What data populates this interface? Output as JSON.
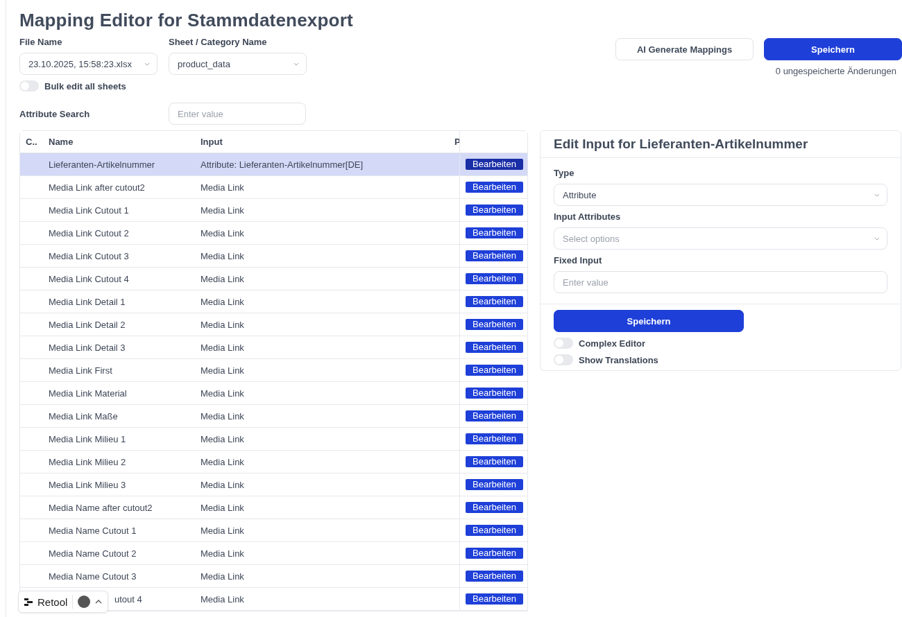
{
  "title": "Mapping Editor for Stammdatenexport",
  "file_name": {
    "label": "File Name",
    "value": "23.10.2025, 15:58:23.xlsx"
  },
  "sheet": {
    "label": "Sheet / Category Name",
    "value": "product_data"
  },
  "bulk_edit": {
    "label": "Bulk edit all sheets",
    "on": false
  },
  "ai_button": "AI Generate Mappings",
  "save_button": "Speichern",
  "unsaved": "0 ungespeicherte Änderungen",
  "attribute_search": {
    "label": "Attribute Search",
    "placeholder": "Enter value"
  },
  "table": {
    "columns": [
      "C..",
      "Name",
      "Input",
      "P"
    ],
    "rows": [
      {
        "name": "Lieferanten-Artikelnummer",
        "input": "Attribute: Lieferanten-Artikelnummer[DE]",
        "action": "Bearbeiten",
        "selected": true
      },
      {
        "name": "Media Link after cutout2",
        "input": "Media Link",
        "action": "Bearbeiten",
        "selected": false
      },
      {
        "name": "Media Link Cutout 1",
        "input": "Media Link",
        "action": "Bearbeiten",
        "selected": false
      },
      {
        "name": "Media Link Cutout 2",
        "input": "Media Link",
        "action": "Bearbeiten",
        "selected": false
      },
      {
        "name": "Media Link Cutout 3",
        "input": "Media Link",
        "action": "Bearbeiten",
        "selected": false
      },
      {
        "name": "Media Link Cutout 4",
        "input": "Media Link",
        "action": "Bearbeiten",
        "selected": false
      },
      {
        "name": "Media Link Detail 1",
        "input": "Media Link",
        "action": "Bearbeiten",
        "selected": false
      },
      {
        "name": "Media Link Detail 2",
        "input": "Media Link",
        "action": "Bearbeiten",
        "selected": false
      },
      {
        "name": "Media Link Detail 3",
        "input": "Media Link",
        "action": "Bearbeiten",
        "selected": false
      },
      {
        "name": "Media Link First",
        "input": "Media Link",
        "action": "Bearbeiten",
        "selected": false
      },
      {
        "name": "Media Link Material",
        "input": "Media Link",
        "action": "Bearbeiten",
        "selected": false
      },
      {
        "name": "Media Link Maße",
        "input": "Media Link",
        "action": "Bearbeiten",
        "selected": false
      },
      {
        "name": "Media Link Milieu 1",
        "input": "Media Link",
        "action": "Bearbeiten",
        "selected": false
      },
      {
        "name": "Media Link Milieu 2",
        "input": "Media Link",
        "action": "Bearbeiten",
        "selected": false
      },
      {
        "name": "Media Link Milieu 3",
        "input": "Media Link",
        "action": "Bearbeiten",
        "selected": false
      },
      {
        "name": "Media Name after cutout2",
        "input": "Media Link",
        "action": "Bearbeiten",
        "selected": false
      },
      {
        "name": "Media Name Cutout 1",
        "input": "Media Link",
        "action": "Bearbeiten",
        "selected": false
      },
      {
        "name": "Media Name Cutout 2",
        "input": "Media Link",
        "action": "Bearbeiten",
        "selected": false
      },
      {
        "name": "Media Name Cutout 3",
        "input": "Media Link",
        "action": "Bearbeiten",
        "selected": false
      },
      {
        "name": "utout 4",
        "input": "Media Link",
        "action": "Bearbeiten",
        "selected": false,
        "kind": "covered"
      }
    ]
  },
  "edit_panel": {
    "title": "Edit Input for Lieferanten-Artikelnummer",
    "type": {
      "label": "Type",
      "value": "Attribute"
    },
    "input_attributes": {
      "label": "Input Attributes",
      "placeholder": "Select options"
    },
    "fixed_input": {
      "label": "Fixed Input",
      "placeholder": "Enter value"
    },
    "save_button": "Speichern",
    "toggles": [
      {
        "label": "Complex Editor",
        "on": false
      },
      {
        "label": "Show Translations",
        "on": false
      }
    ]
  },
  "badge": {
    "brand": "Retool"
  }
}
